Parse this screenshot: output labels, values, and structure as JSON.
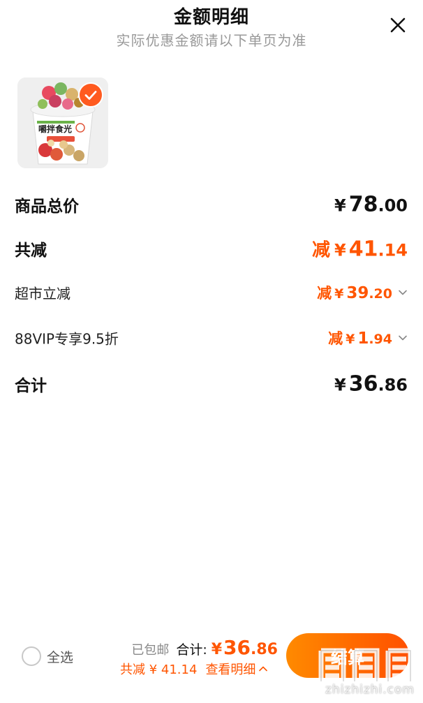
{
  "header": {
    "title": "金额明细",
    "subtitle": "实际优惠金额请以下单页为准"
  },
  "rows": [
    {
      "label": "商品总价",
      "prefix": "",
      "currency": "¥",
      "int": "78",
      "dec": ".00",
      "color": "#111111"
    },
    {
      "label": "共减",
      "prefix": "减",
      "currency": "¥",
      "int": "41",
      "dec": ".14",
      "color": "#ff5500"
    },
    {
      "label": "超市立减",
      "prefix": "减",
      "currency": "¥",
      "int": "39",
      "dec": ".20",
      "color": "#ff5500"
    },
    {
      "label": "88VIP专享9.5折",
      "prefix": "减",
      "currency": "¥",
      "int": "1",
      "dec": ".94",
      "color": "#ff5500"
    },
    {
      "label": "合计",
      "prefix": "",
      "currency": "¥",
      "int": "36",
      "dec": ".86",
      "color": "#111111"
    }
  ],
  "bottom": {
    "select_all": "全选",
    "shipping": "已包邮",
    "total_label": "合计:",
    "total_currency": "¥",
    "total_int": "36",
    "total_dec": ".86",
    "discount_text": "共减 ¥ 41.14",
    "detail_link": "查看明细",
    "checkout_label": "结算"
  },
  "watermark": {
    "text": "zhizhizhi.com"
  },
  "icons": {
    "close": "close-icon",
    "check": "check-icon",
    "chevron_down": "chevron-down-icon",
    "chevron_up": "chevron-up-icon"
  },
  "colors": {
    "accent": "#ff5500",
    "button_gradient_start": "#ff8a00",
    "button_gradient_end": "#ff5000"
  }
}
